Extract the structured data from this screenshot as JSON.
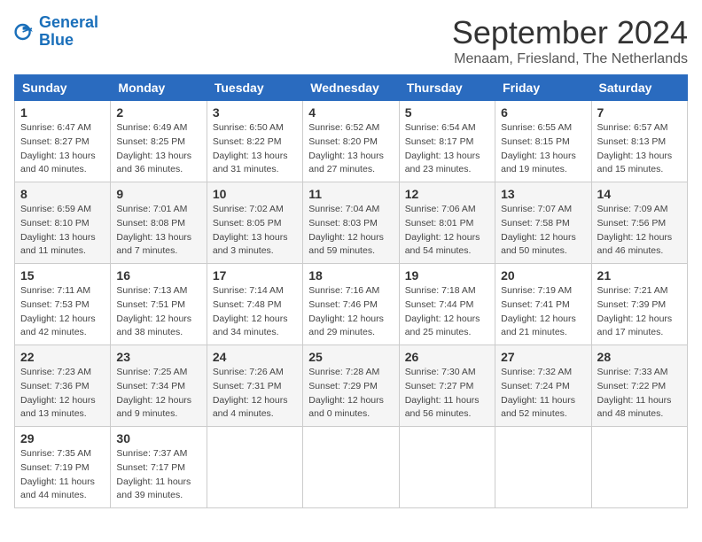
{
  "header": {
    "logo_line1": "General",
    "logo_line2": "Blue",
    "month_title": "September 2024",
    "subtitle": "Menaam, Friesland, The Netherlands"
  },
  "columns": [
    "Sunday",
    "Monday",
    "Tuesday",
    "Wednesday",
    "Thursday",
    "Friday",
    "Saturday"
  ],
  "weeks": [
    [
      {
        "day": "1",
        "info": "Sunrise: 6:47 AM\nSunset: 8:27 PM\nDaylight: 13 hours\nand 40 minutes."
      },
      {
        "day": "2",
        "info": "Sunrise: 6:49 AM\nSunset: 8:25 PM\nDaylight: 13 hours\nand 36 minutes."
      },
      {
        "day": "3",
        "info": "Sunrise: 6:50 AM\nSunset: 8:22 PM\nDaylight: 13 hours\nand 31 minutes."
      },
      {
        "day": "4",
        "info": "Sunrise: 6:52 AM\nSunset: 8:20 PM\nDaylight: 13 hours\nand 27 minutes."
      },
      {
        "day": "5",
        "info": "Sunrise: 6:54 AM\nSunset: 8:17 PM\nDaylight: 13 hours\nand 23 minutes."
      },
      {
        "day": "6",
        "info": "Sunrise: 6:55 AM\nSunset: 8:15 PM\nDaylight: 13 hours\nand 19 minutes."
      },
      {
        "day": "7",
        "info": "Sunrise: 6:57 AM\nSunset: 8:13 PM\nDaylight: 13 hours\nand 15 minutes."
      }
    ],
    [
      {
        "day": "8",
        "info": "Sunrise: 6:59 AM\nSunset: 8:10 PM\nDaylight: 13 hours\nand 11 minutes."
      },
      {
        "day": "9",
        "info": "Sunrise: 7:01 AM\nSunset: 8:08 PM\nDaylight: 13 hours\nand 7 minutes."
      },
      {
        "day": "10",
        "info": "Sunrise: 7:02 AM\nSunset: 8:05 PM\nDaylight: 13 hours\nand 3 minutes."
      },
      {
        "day": "11",
        "info": "Sunrise: 7:04 AM\nSunset: 8:03 PM\nDaylight: 12 hours\nand 59 minutes."
      },
      {
        "day": "12",
        "info": "Sunrise: 7:06 AM\nSunset: 8:01 PM\nDaylight: 12 hours\nand 54 minutes."
      },
      {
        "day": "13",
        "info": "Sunrise: 7:07 AM\nSunset: 7:58 PM\nDaylight: 12 hours\nand 50 minutes."
      },
      {
        "day": "14",
        "info": "Sunrise: 7:09 AM\nSunset: 7:56 PM\nDaylight: 12 hours\nand 46 minutes."
      }
    ],
    [
      {
        "day": "15",
        "info": "Sunrise: 7:11 AM\nSunset: 7:53 PM\nDaylight: 12 hours\nand 42 minutes."
      },
      {
        "day": "16",
        "info": "Sunrise: 7:13 AM\nSunset: 7:51 PM\nDaylight: 12 hours\nand 38 minutes."
      },
      {
        "day": "17",
        "info": "Sunrise: 7:14 AM\nSunset: 7:48 PM\nDaylight: 12 hours\nand 34 minutes."
      },
      {
        "day": "18",
        "info": "Sunrise: 7:16 AM\nSunset: 7:46 PM\nDaylight: 12 hours\nand 29 minutes."
      },
      {
        "day": "19",
        "info": "Sunrise: 7:18 AM\nSunset: 7:44 PM\nDaylight: 12 hours\nand 25 minutes."
      },
      {
        "day": "20",
        "info": "Sunrise: 7:19 AM\nSunset: 7:41 PM\nDaylight: 12 hours\nand 21 minutes."
      },
      {
        "day": "21",
        "info": "Sunrise: 7:21 AM\nSunset: 7:39 PM\nDaylight: 12 hours\nand 17 minutes."
      }
    ],
    [
      {
        "day": "22",
        "info": "Sunrise: 7:23 AM\nSunset: 7:36 PM\nDaylight: 12 hours\nand 13 minutes."
      },
      {
        "day": "23",
        "info": "Sunrise: 7:25 AM\nSunset: 7:34 PM\nDaylight: 12 hours\nand 9 minutes."
      },
      {
        "day": "24",
        "info": "Sunrise: 7:26 AM\nSunset: 7:31 PM\nDaylight: 12 hours\nand 4 minutes."
      },
      {
        "day": "25",
        "info": "Sunrise: 7:28 AM\nSunset: 7:29 PM\nDaylight: 12 hours\nand 0 minutes."
      },
      {
        "day": "26",
        "info": "Sunrise: 7:30 AM\nSunset: 7:27 PM\nDaylight: 11 hours\nand 56 minutes."
      },
      {
        "day": "27",
        "info": "Sunrise: 7:32 AM\nSunset: 7:24 PM\nDaylight: 11 hours\nand 52 minutes."
      },
      {
        "day": "28",
        "info": "Sunrise: 7:33 AM\nSunset: 7:22 PM\nDaylight: 11 hours\nand 48 minutes."
      }
    ],
    [
      {
        "day": "29",
        "info": "Sunrise: 7:35 AM\nSunset: 7:19 PM\nDaylight: 11 hours\nand 44 minutes."
      },
      {
        "day": "30",
        "info": "Sunrise: 7:37 AM\nSunset: 7:17 PM\nDaylight: 11 hours\nand 39 minutes."
      },
      {
        "day": "",
        "info": ""
      },
      {
        "day": "",
        "info": ""
      },
      {
        "day": "",
        "info": ""
      },
      {
        "day": "",
        "info": ""
      },
      {
        "day": "",
        "info": ""
      }
    ]
  ]
}
